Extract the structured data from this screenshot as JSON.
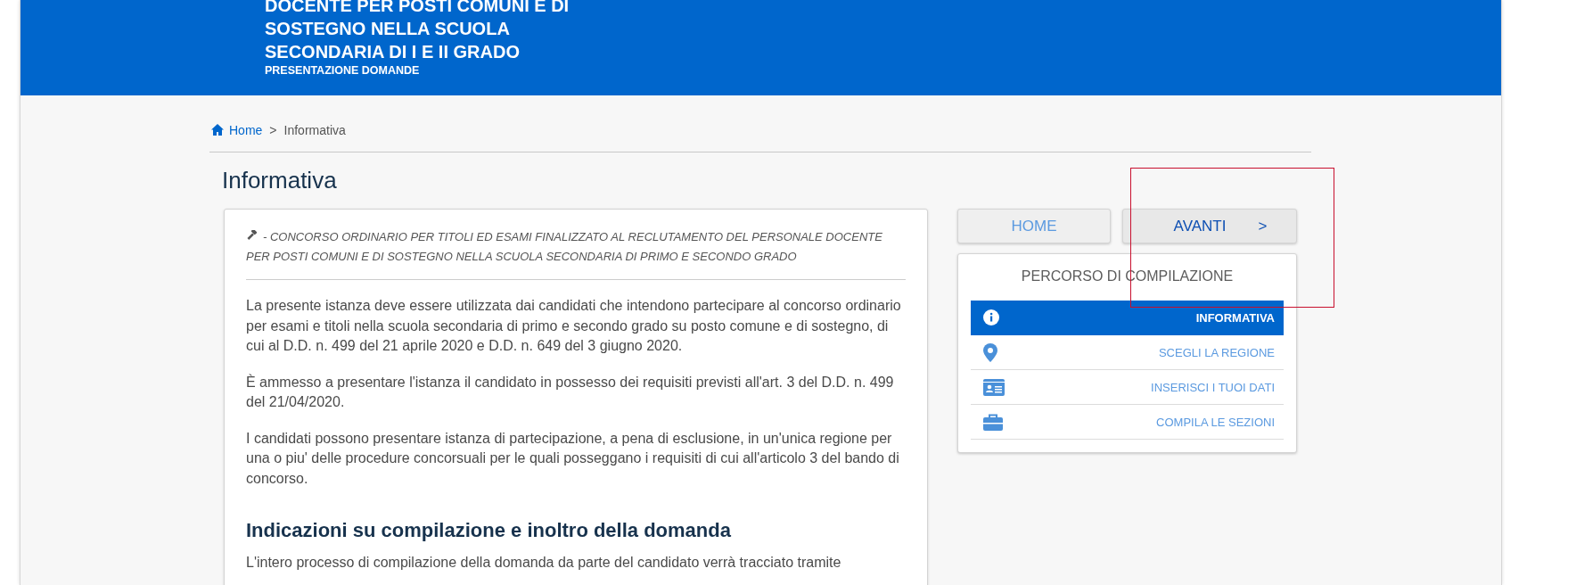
{
  "header": {
    "title_lines": [
      "DOCENTE PER POSTI COMUNI E DI",
      "SOSTEGNO NELLA SCUOLA",
      "SECONDARIA DI I E II GRADO"
    ],
    "subtitle": "PRESENTAZIONE DOMANDE"
  },
  "breadcrumb": [
    {
      "label": "Home",
      "kind": "link"
    },
    {
      "label": ">",
      "kind": "separator"
    },
    {
      "label": "Informativa",
      "kind": "current"
    }
  ],
  "page_title": "Informativa",
  "notice": {
    "dash": "-",
    "heading": "CONCORSO ORDINARIO PER TITOLI ED ESAMI FINALIZZATO AL RECLUTAMENTO DEL PERSONALE DOCENTE PER POSTI COMUNI E DI SOSTEGNO NELLA SCUOLA SECONDARIA DI PRIMO E SECONDO GRADO",
    "paragraphs": [
      "La presente istanza deve essere utilizzata dai candidati che intendono partecipare al concorso ordinario per esami e titoli nella scuola secondaria di primo e secondo grado su posto comune e di sostegno, di cui al D.D. n. 499 del 21 aprile 2020 e D.D. n. 649 del 3 giugno 2020.",
      "È ammesso a presentare l'istanza il candidato in possesso dei requisiti previsti all'art. 3 del D.D. n. 499 del 21/04/2020.",
      "I candidati possono presentare istanza di partecipazione, a pena di esclusione, in un'unica regione per una o piu' delle procedure concorsuali per le quali posseggano i requisiti di cui all'articolo 3 del bando di concorso."
    ],
    "section_title": "Indicazioni su compilazione e inoltro della domanda",
    "section_text": "L'intero processo di compilazione della domanda da parte del candidato verrà tracciato tramite"
  },
  "nav_buttons": [
    {
      "label": "HOME",
      "kind": "home"
    },
    {
      "label": "AVANTI",
      "kind": "next",
      "arrow": ">"
    }
  ],
  "steps_panel": {
    "title": "PERCORSO DI COMPILAZIONE",
    "steps": [
      {
        "label": "INFORMATIVA",
        "kind": "info",
        "selected": true
      },
      {
        "label": "SCEGLI LA REGIONE",
        "kind": "region",
        "selected": false
      },
      {
        "label": "INSERISCI I TUOI DATI",
        "kind": "data",
        "selected": false
      },
      {
        "label": "COMPILA LE SEZIONI",
        "kind": "sections",
        "selected": false
      }
    ]
  }
}
